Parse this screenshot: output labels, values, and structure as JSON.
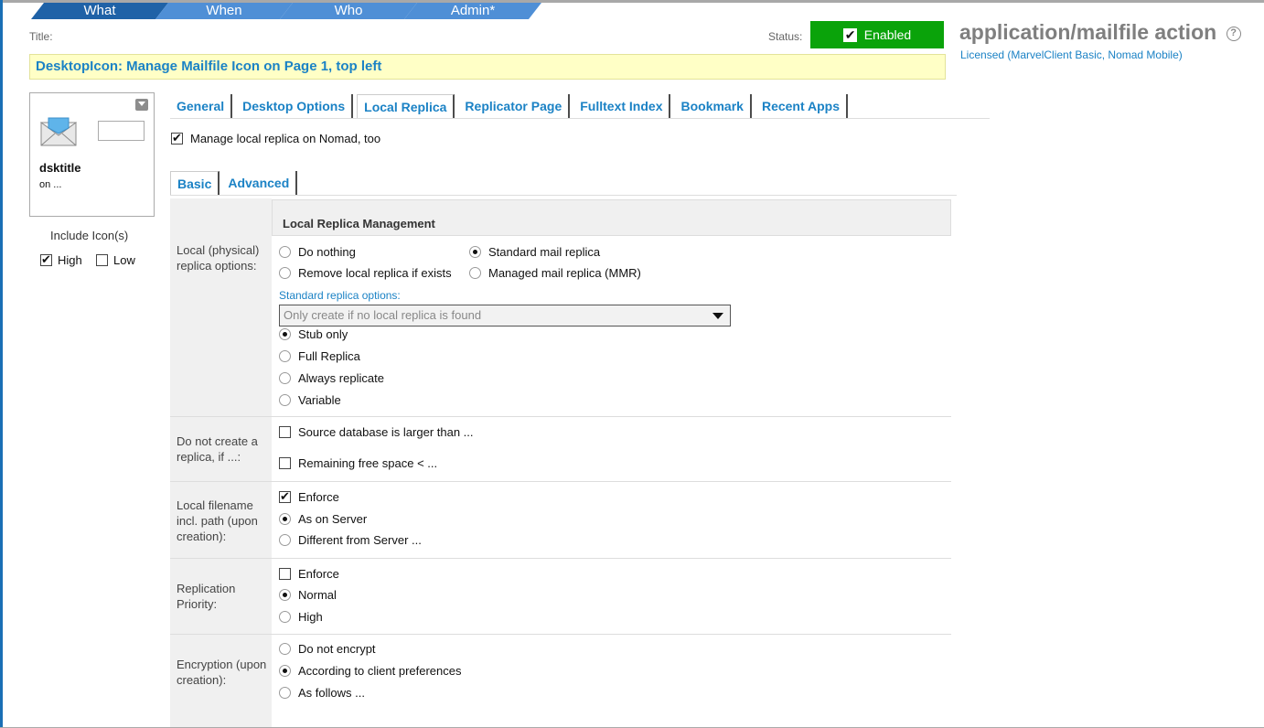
{
  "nav_tabs": [
    "What",
    "When",
    "Who",
    "Admin*"
  ],
  "title_label": "Title:",
  "status_label": "Status:",
  "status_value": "Enabled",
  "title_value": "DesktopIcon: Manage Mailfile Icon on Page 1, top left",
  "app_title": "application/mailfile action",
  "help_icon": "?",
  "licensed": "Licensed (MarvelClient Basic, Nomad Mobile)",
  "icon_preview": {
    "title": "dsktitle",
    "subtitle": "on ..."
  },
  "include_icons": {
    "label": "Include Icon(s)",
    "high": "High",
    "low": "Low",
    "high_checked": true,
    "low_checked": false
  },
  "tabs": [
    "General",
    "Desktop Options",
    "Local Replica",
    "Replicator Page",
    "Fulltext Index",
    "Bookmark",
    "Recent Apps"
  ],
  "active_tab": "Local Replica",
  "manage_nomad": {
    "label": "Manage local replica on Nomad, too",
    "checked": true
  },
  "sub_tabs": [
    "Basic",
    "Advanced"
  ],
  "section_title": "Local Replica Management",
  "local_options": {
    "label": "Local (physical) replica options:",
    "do_nothing": "Do nothing",
    "standard": "Standard mail replica",
    "remove": "Remove local replica if exists",
    "managed": "Managed mail replica (MMR)",
    "std_options_label": "Standard replica options:",
    "select_value": "Only create if no local replica is found",
    "stub": "Stub only",
    "full": "Full Replica",
    "always": "Always replicate",
    "variable": "Variable"
  },
  "do_not_create": {
    "label": "Do not create a replica, if ...:",
    "larger": "Source database is larger than ...",
    "free": "Remaining free space < ..."
  },
  "local_filename": {
    "label": "Local filename incl. path (upon creation):",
    "enforce": "Enforce",
    "as_server": "As on Server",
    "different": "Different from Server ..."
  },
  "priority": {
    "label": "Replication Priority:",
    "enforce": "Enforce",
    "normal": "Normal",
    "high": "High"
  },
  "encryption": {
    "label": "Encryption (upon creation):",
    "none": "Do not encrypt",
    "client": "According to client preferences",
    "follows": "As follows ..."
  },
  "colors": {
    "accent": "#1b82c5",
    "status_green": "#0aa30a",
    "title_bg": "#ffffc6",
    "nav_blue": "#2d78c4"
  }
}
